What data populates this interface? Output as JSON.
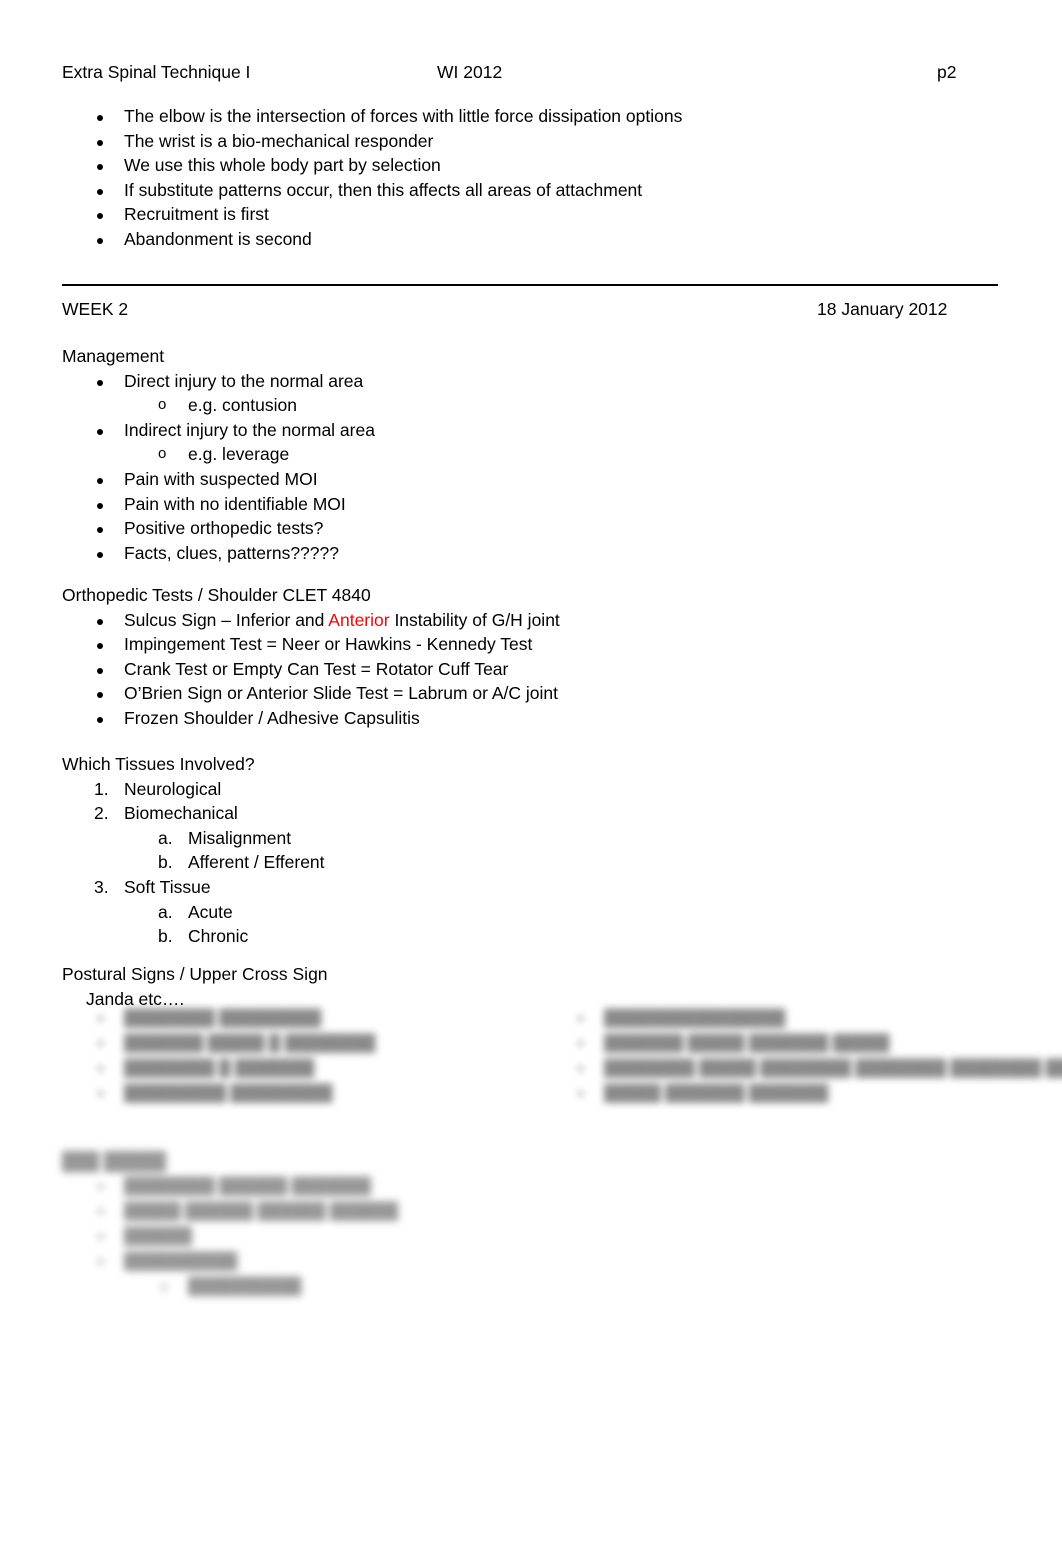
{
  "document": {
    "page_background": "#ffffff",
    "text_color": "#000000",
    "accent_color": "#FF0000"
  },
  "header": {
    "title": "Extra Spinal Technique I",
    "term": "WI 2012",
    "page_label": "p2"
  },
  "top_bullets": [
    "The elbow is the intersection of forces with little force dissipation options",
    "The wrist is a bio-mechanical responder",
    "We use this whole body part by selection",
    "If substitute patterns occur, then this affects all areas of attachment",
    "Recruitment is first",
    "Abandonment is second"
  ],
  "separator": {
    "glyph": "__________________________________________________________________________"
  },
  "week_banner": {
    "label": "WEEK 2",
    "date": "18 January 2012"
  },
  "management": {
    "heading": "Management",
    "items": [
      {
        "text": "Direct injury to the normal area",
        "sub": [
          "e.g. contusion"
        ]
      },
      {
        "text": "Indirect injury to the normal area",
        "sub": [
          "e.g. leverage"
        ]
      },
      {
        "text": "Pain with suspected MOI",
        "sub": []
      },
      {
        "text": "Pain with no identifiable MOI",
        "sub": []
      },
      {
        "text": "Positive orthopedic tests?",
        "sub": []
      },
      {
        "text": "Facts, clues, patterns?????",
        "sub": []
      }
    ]
  },
  "orthopedic": {
    "heading": "Orthopedic Tests / Shoulder CLET 4840",
    "sulcus": {
      "before": "Sulcus Sign – Inferior and ",
      "highlight": "Anterior",
      "after": " Instability of G/H joint"
    },
    "items": [
      "Impingement Test = Neer or Hawkins - Kennedy Test",
      "Crank Test or Empty Can Test = Rotator Cuff Tear",
      "O’Brien Sign or Anterior Slide Test = Labrum or A/C joint",
      "Frozen Shoulder / Adhesive Capsulitis"
    ]
  },
  "tissues": {
    "heading": "Which Tissues Involved?",
    "items": [
      {
        "text": "Neurological",
        "sub": []
      },
      {
        "text": "Biomechanical",
        "sub": [
          "Misalignment",
          "Afferent / Efferent"
        ]
      },
      {
        "text": "Soft Tissue",
        "sub": [
          "Acute",
          "Chronic"
        ]
      }
    ]
  },
  "postural": {
    "heading": "Postural Signs / Upper Cross Sign",
    "subheading": "Janda etc…."
  },
  "redacted": {
    "note": "illegible blurred text",
    "left_column": [
      "████████ █████████",
      "███████ █████ █ ████████",
      "████████ █ ███████",
      "█████████ █████████"
    ],
    "right_column": [
      "████████████████",
      "███████ █████ ███████ █████",
      "████████ █████ ████████ ████████ ████████ █████ ██████ ████████",
      "█████ ███████ ███████"
    ],
    "bottom_heading": "███ █████",
    "bottom_items": [
      "████████ ██████ ███████",
      "█████ ██████ ██████ ██████",
      "██████",
      "██████████"
    ],
    "bottom_sub": [
      "██████████"
    ]
  }
}
